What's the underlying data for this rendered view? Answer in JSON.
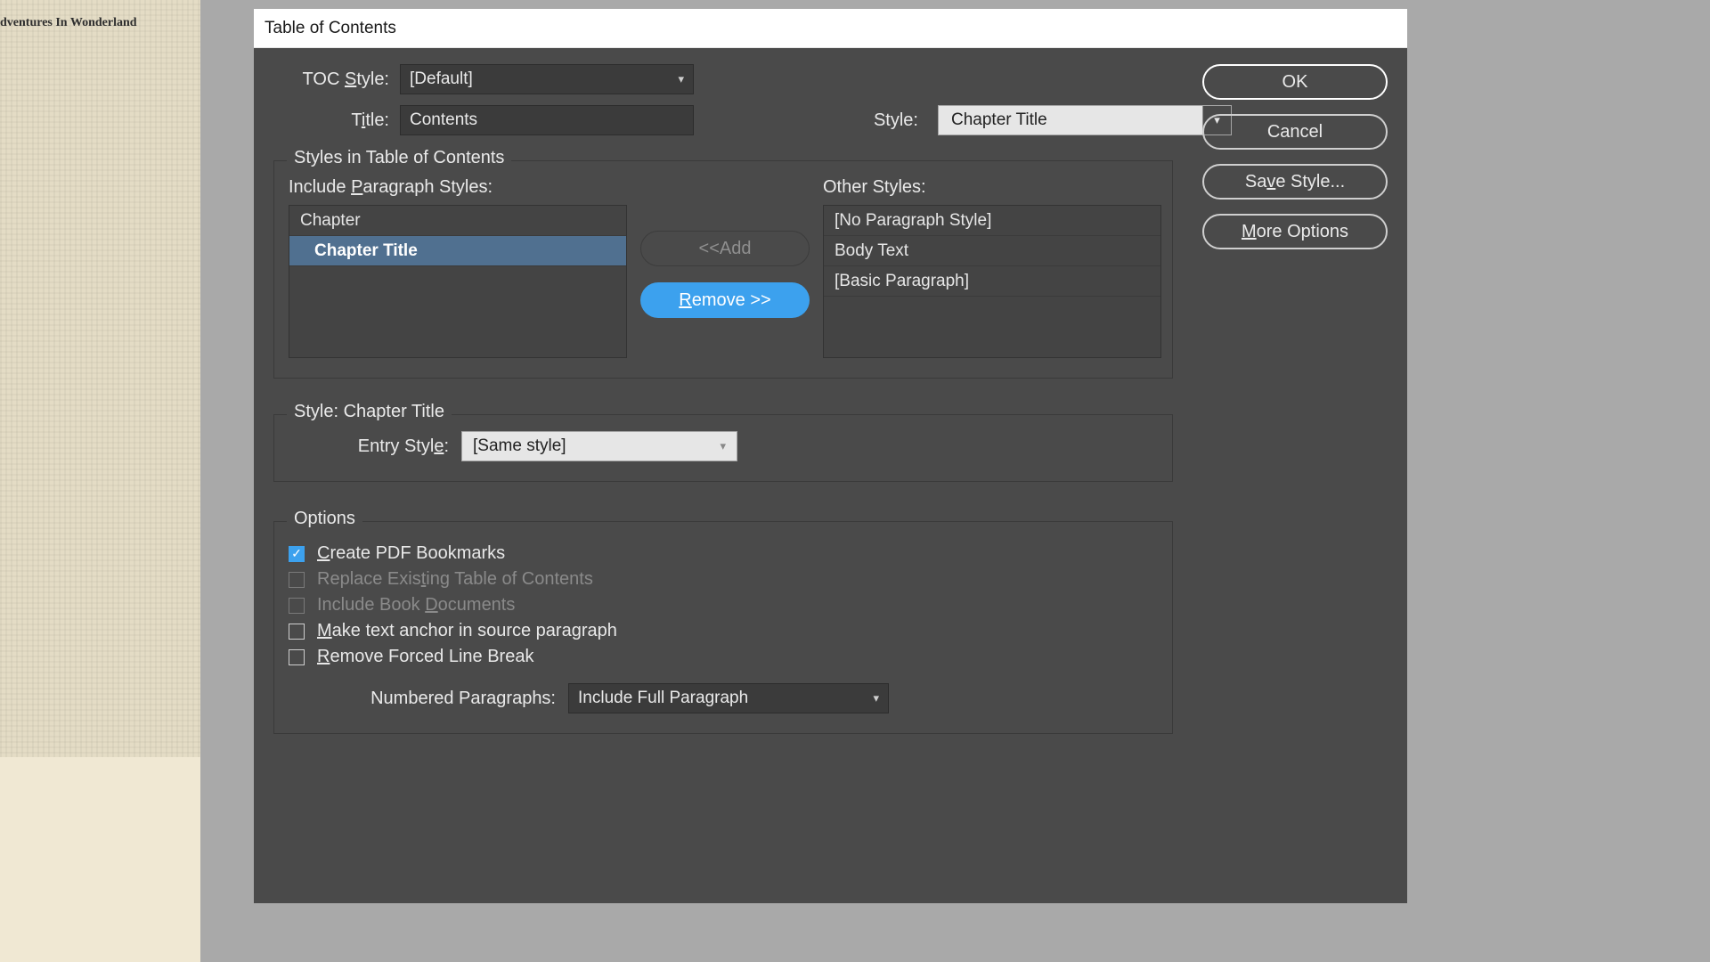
{
  "background_page_title": "dventures In Wonderland",
  "dialog": {
    "title": "Table of Contents",
    "toc_style_label_pre": "TOC ",
    "toc_style_label_u": "S",
    "toc_style_label_post": "tyle:",
    "toc_style_value": "[Default]",
    "title_label_pre": "T",
    "title_label_u": "i",
    "title_label_post": "tle:",
    "title_value": "Contents",
    "title_style_label": "Style:",
    "title_style_value": "Chapter Title",
    "buttons": {
      "ok": "OK",
      "cancel": "Cancel",
      "save_style_pre": "Sa",
      "save_style_u": "v",
      "save_style_post": "e Style...",
      "more_opts_u": "M",
      "more_opts_post": "ore Options"
    },
    "styles_group": {
      "title": "Styles in Table of Contents",
      "include_label_pre": "Include ",
      "include_label_u": "P",
      "include_label_post": "aragraph Styles:",
      "other_label": "Other Styles:",
      "included": [
        "Chapter",
        "Chapter Title"
      ],
      "included_selected_index": 1,
      "other": [
        "[No Paragraph Style]",
        "Body Text",
        "[Basic Paragraph]"
      ],
      "add_btn_pre": "<< ",
      "add_btn_u": "A",
      "add_btn_post": "dd",
      "remove_btn_u": "R",
      "remove_btn_post": "emove >>"
    },
    "entry_group": {
      "title": "Style: Chapter Title",
      "entry_style_label_pre": "Entry Styl",
      "entry_style_label_u": "e",
      "entry_style_label_post": ":",
      "entry_style_value": "[Same style]"
    },
    "options_group": {
      "title": "Options",
      "opt1_u": "C",
      "opt1_post": "reate PDF Bookmarks",
      "opt2_pre": "Replace Exis",
      "opt2_u": "t",
      "opt2_post": "ing Table of Contents",
      "opt3_pre": "Include Book ",
      "opt3_u": "D",
      "opt3_post": "ocuments",
      "opt4_u": "M",
      "opt4_post": "ake text anchor in source paragraph",
      "opt5_u": "R",
      "opt5_post": "emove Forced Line Break",
      "num_para_label_pre": "Numbered Para",
      "num_para_label_u": "g",
      "num_para_label_post": "raphs:",
      "num_para_value": "Include Full Paragraph"
    }
  }
}
